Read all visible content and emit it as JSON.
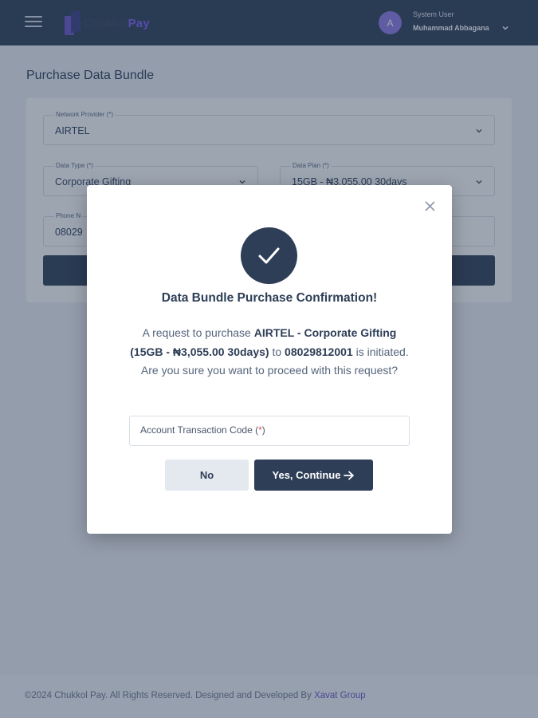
{
  "header": {
    "logo_part1": "Chukkol",
    "logo_part2": "Pay",
    "avatar_initial": "A",
    "user_role": "System User",
    "user_name": "Muhammad Abbagana"
  },
  "page": {
    "title": "Purchase Data Bundle"
  },
  "form": {
    "network_provider": {
      "label": "Network Provider (*)",
      "value": "AIRTEL"
    },
    "data_type": {
      "label": "Data Type (*)",
      "value": "Corporate Gifting"
    },
    "data_plan": {
      "label": "Data Plan (*)",
      "value": "15GB - ₦3,055.00 30days"
    },
    "phone": {
      "label": "Phone N",
      "value": "08029"
    }
  },
  "footer": {
    "text": "©2024 Chukkol Pay. All Rights Reserved. Designed and Developed By",
    "link": "Xavat Group"
  },
  "modal": {
    "title": "Data Bundle Purchase Confirmation!",
    "msg_part1": "A request to purchase ",
    "msg_provider_type": "AIRTEL - Corporate Gifting",
    "msg_plan": "(15GB - ₦3,055.00 30days)",
    "msg_part2": " to ",
    "msg_phone": "08029812001",
    "msg_part3": " is initiated. Are you sure you want to proceed with this request?",
    "code_label": "Account Transaction Code (",
    "code_required": "*",
    "code_label_end": ")",
    "no_label": "No",
    "yes_label": "Yes, Continue"
  },
  "icons": {
    "menu": "hamburger-menu-icon",
    "chevron": "chevron-down-icon",
    "close": "close-icon",
    "check": "check-icon",
    "arrow": "arrow-right-icon"
  },
  "colors": {
    "primary": "#2e3e57",
    "brand": "#7a5ff0",
    "avatar": "#8f7be6",
    "required": "#d9534f"
  }
}
